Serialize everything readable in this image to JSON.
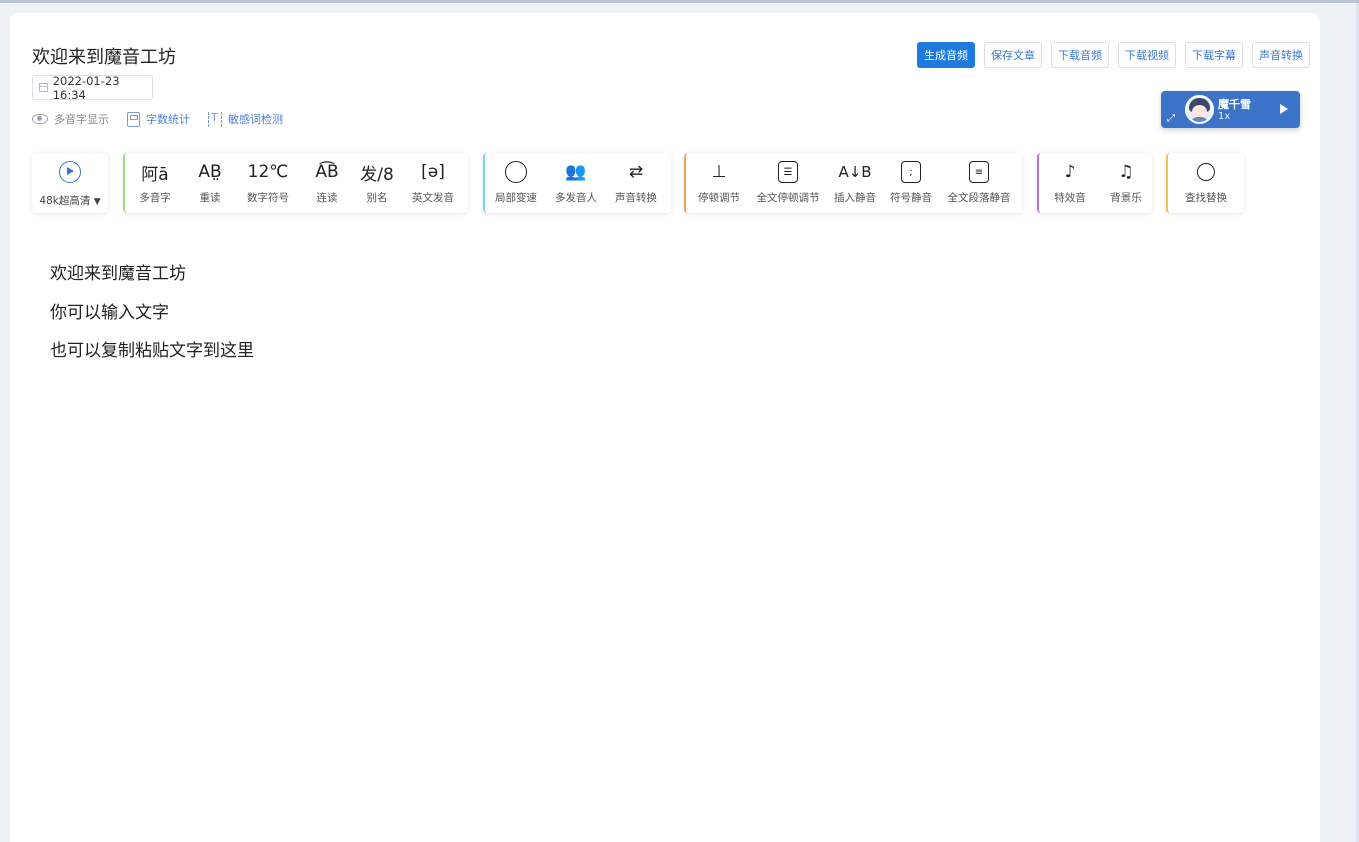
{
  "document": {
    "title": "欢迎来到魔音工坊",
    "date": "2022-01-23 16:34"
  },
  "tools_row": [
    {
      "label": "多音字显示",
      "icon": "eye-icon"
    },
    {
      "label": "字数统计",
      "icon": "calculator-icon"
    },
    {
      "label": "敏感词检测",
      "icon": "scan-text-icon"
    }
  ],
  "top_buttons": {
    "generate": "生成音频",
    "save": "保存文章",
    "download_audio": "下载音频",
    "download_video": "下载视频",
    "download_subtitle": "下载字幕",
    "voice_convert": "声音转换"
  },
  "player": {
    "voice_name": "魔千雪",
    "speed": "1x"
  },
  "quality": {
    "selected": "48k超高清"
  },
  "toolbar_groups": {
    "pronunciation": {
      "accent": "#a5d98a",
      "items": [
        {
          "label": "多音字",
          "glyph": "阿ā"
        },
        {
          "label": "重读",
          "glyph": "AB̤"
        },
        {
          "label": "数字符号",
          "glyph": "12℃"
        },
        {
          "label": "连读",
          "glyph": "A͡B"
        },
        {
          "label": "别名",
          "glyph": "发/8"
        },
        {
          "label": "英文发音",
          "glyph": "[ə]"
        }
      ]
    },
    "speed_voice": {
      "accent": "#7fd3e8",
      "items": [
        {
          "label": "局部变速",
          "icon": "speedometer-icon"
        },
        {
          "label": "多发音人",
          "icon": "users-icon"
        },
        {
          "label": "声音转换",
          "icon": "voice-convert-icon"
        }
      ]
    },
    "pause": {
      "accent": "#f0a35e",
      "items": [
        {
          "label": "停顿调节",
          "icon": "pause-adjust-icon"
        },
        {
          "label": "全文停顿调节",
          "icon": "sliders-icon"
        },
        {
          "label": "插入静音",
          "glyph": "A↓B"
        },
        {
          "label": "符号静音",
          "icon": "symbol-mute-icon"
        },
        {
          "label": "全文段落静音",
          "icon": "paragraph-mute-icon"
        }
      ]
    },
    "effects": {
      "accent": "#b57ad0",
      "items": [
        {
          "label": "特效音",
          "icon": "sound-effect-icon"
        },
        {
          "label": "背景乐",
          "icon": "music-icon"
        }
      ]
    },
    "search": {
      "accent": "#f1c35a",
      "items": [
        {
          "label": "查找替换",
          "icon": "search-icon"
        }
      ]
    }
  },
  "editor_lines": [
    "欢迎来到魔音工坊",
    "你可以输入文字",
    "也可以复制粘贴文字到这里"
  ]
}
